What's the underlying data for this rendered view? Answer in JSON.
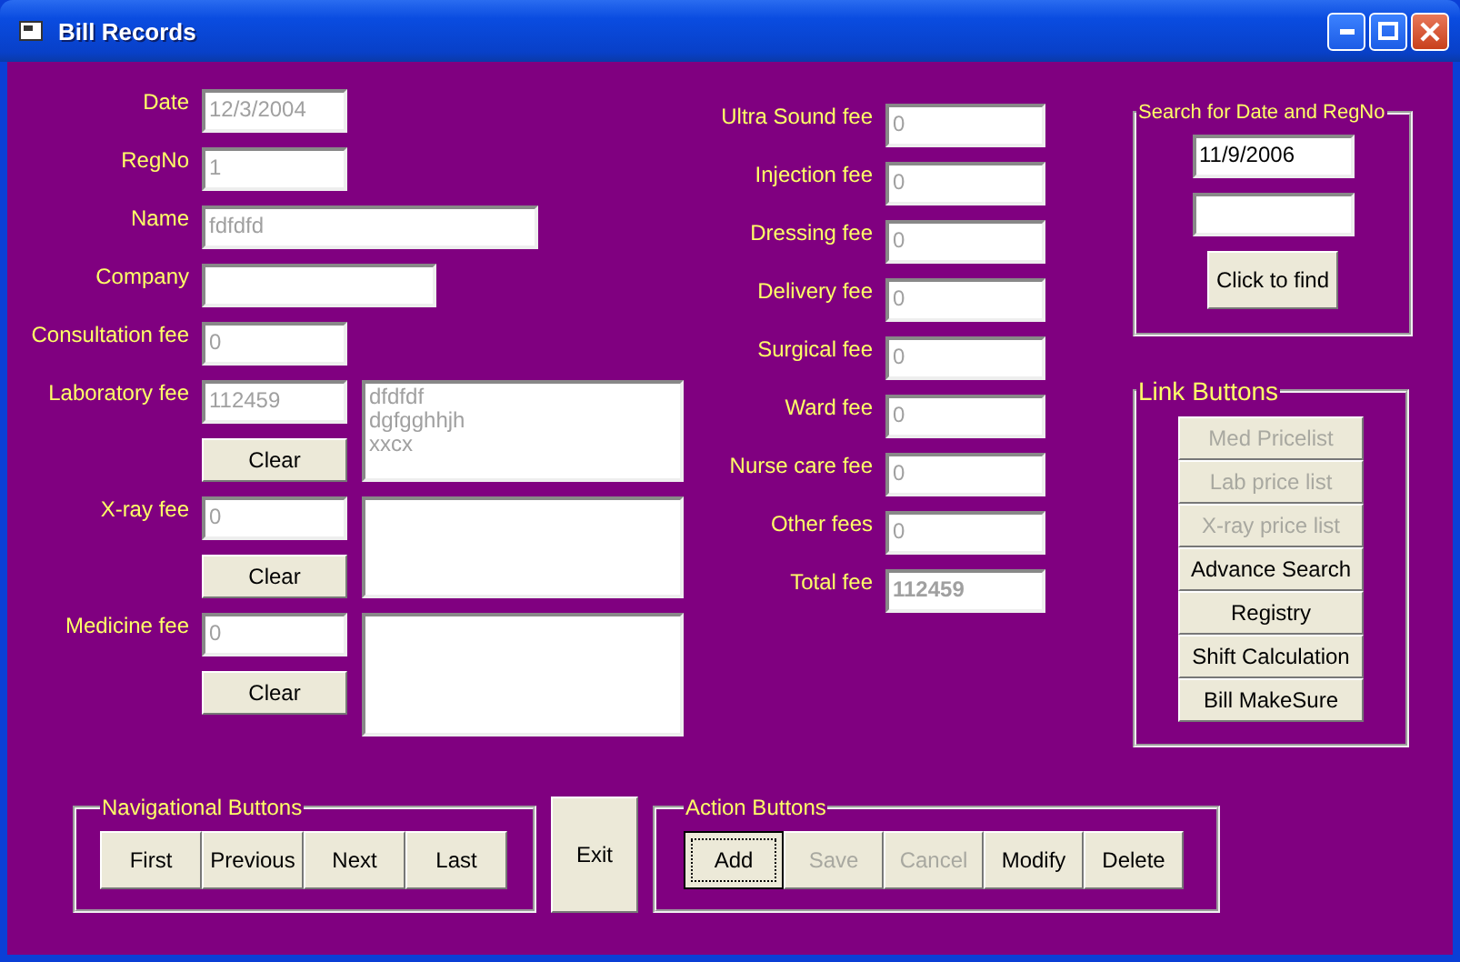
{
  "window": {
    "title": "Bill Records"
  },
  "patient": [
    {
      "label": "Date",
      "value": "12/3/2004",
      "disabled": true
    },
    {
      "label": "RegNo",
      "value": "1",
      "disabled": true
    },
    {
      "label": "Name",
      "value": "fdfdfd",
      "disabled": true
    },
    {
      "label": "Company"
    }
  ],
  "fees_left": [
    {
      "label": "Consultation fee",
      "value": "0",
      "disabled": true
    },
    {
      "label": "Laboratory fee",
      "value": "112459",
      "disabled": true,
      "clear_button": "Clear",
      "notes": [
        "dfdfdf",
        "dgfgghhjh",
        "xxcx"
      ]
    },
    {
      "label": "X-ray fee",
      "value": "0",
      "disabled": true,
      "clear_button": "Clear"
    },
    {
      "label": "Medicine fee",
      "value": "0",
      "disabled": true,
      "clear_button": "Clear"
    }
  ],
  "fees_right": [
    {
      "label": "Ultra Sound fee",
      "value": "0",
      "disabled": true
    },
    {
      "label": "Injection fee",
      "value": "0",
      "disabled": true
    },
    {
      "label": "Dressing fee",
      "value": "0",
      "disabled": true
    },
    {
      "label": "Delivery fee",
      "value": "0",
      "disabled": true
    },
    {
      "label": "Surgical fee",
      "value": "0",
      "disabled": true
    },
    {
      "label": "Ward fee",
      "value": "0",
      "disabled": true
    },
    {
      "label": "Nurse care fee",
      "value": "0",
      "disabled": true
    },
    {
      "label": "Other fees",
      "value": "0",
      "disabled": true
    }
  ],
  "total": {
    "label": "Total fee",
    "value": "112459",
    "disabled": true
  },
  "search": {
    "title": "Search for Date and RegNo",
    "date": "11/9/2006",
    "button": "Click to find"
  },
  "link_buttons": {
    "title": "Link Buttons",
    "items": [
      {
        "label": "Med Pricelist",
        "disabled": true
      },
      {
        "label": "Lab price list",
        "disabled": true
      },
      {
        "label": "X-ray price list",
        "disabled": true
      },
      {
        "label": "Advance Search",
        "disabled": false
      },
      {
        "label": "Registry",
        "disabled": false
      },
      {
        "label": "Shift Calculation",
        "disabled": false
      },
      {
        "label": "Bill MakeSure",
        "disabled": false
      }
    ]
  },
  "navigation": {
    "title": "Navigational Buttons",
    "items": [
      "First",
      "Previous",
      "Next",
      "Last"
    ]
  },
  "exit_button": "Exit",
  "actions": {
    "title": "Action Buttons",
    "items": [
      {
        "label": "Add",
        "disabled": false,
        "focused": true
      },
      {
        "label": "Save",
        "disabled": true,
        "focused": false
      },
      {
        "label": "Cancel",
        "disabled": true,
        "focused": false
      },
      {
        "label": "Modify",
        "disabled": false,
        "focused": false
      },
      {
        "label": "Delete",
        "disabled": false,
        "focused": false
      }
    ]
  }
}
